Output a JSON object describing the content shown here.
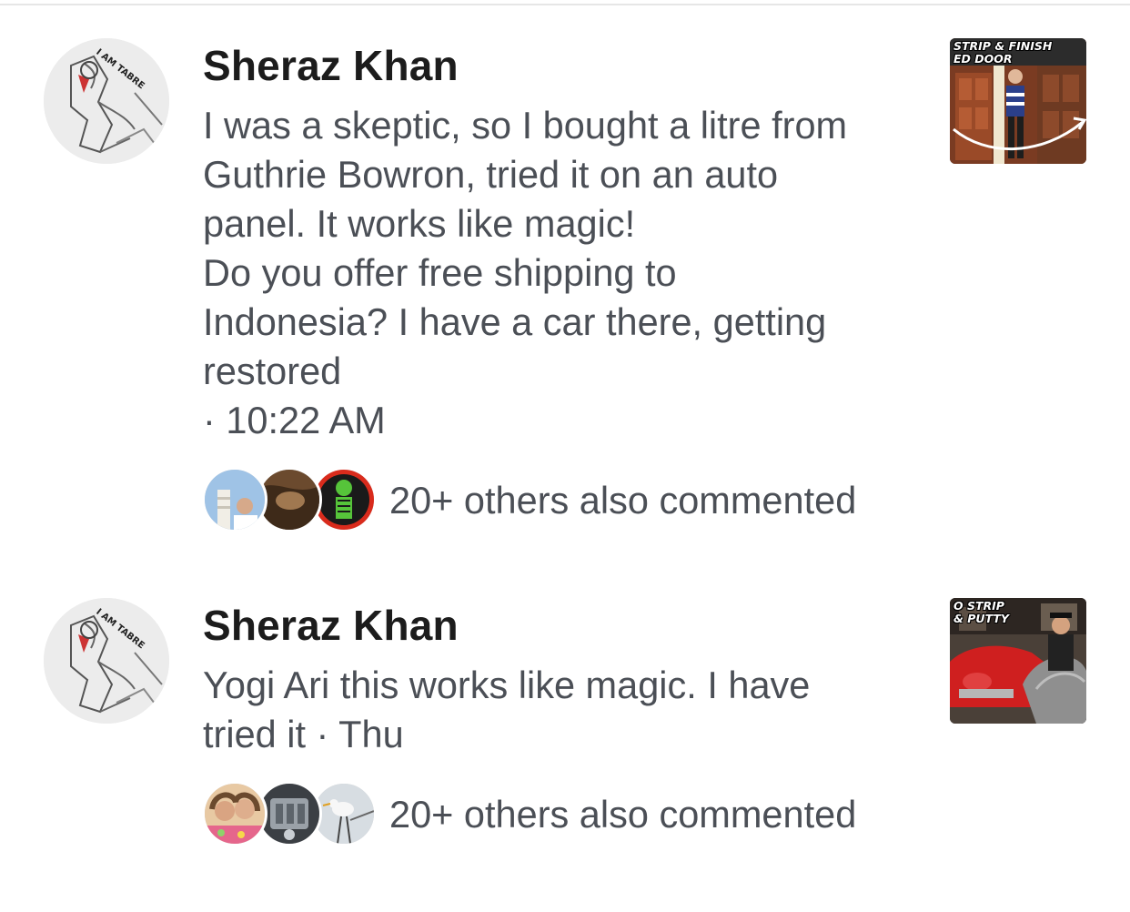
{
  "comments": [
    {
      "author": "Sheraz Khan",
      "text_lines": [
        "I was a skeptic, so I bought a litre from",
        "Guthrie Bowron, tried it on an auto",
        "panel. It works like magic!",
        "Do you offer free shipping to",
        "Indonesia? I have a car there, getting",
        "restored"
      ],
      "time": " · 10:22 AM",
      "avatar_text": "I AM TABRE",
      "thumbnail_caption": "STRIP & FINISH\nED DOOR",
      "others_text": "20+ others also commented",
      "avatar_icon": "sketch-avatar-icon",
      "thumbnail_icon": "door-video-thumbnail"
    },
    {
      "author": "Sheraz Khan",
      "text_lines": [
        "Yogi Ari this works like magic. I have",
        "tried it  · Thu"
      ],
      "time": "",
      "avatar_text": "I AM TABRE",
      "thumbnail_caption": "O STRIP\n& PUTTY",
      "others_text": "20+ others also commented",
      "avatar_icon": "sketch-avatar-icon",
      "thumbnail_icon": "car-video-thumbnail"
    }
  ],
  "colors": {
    "name": "#1c1c1c",
    "body": "#4b4f56",
    "divider": "#e6e6e6"
  }
}
